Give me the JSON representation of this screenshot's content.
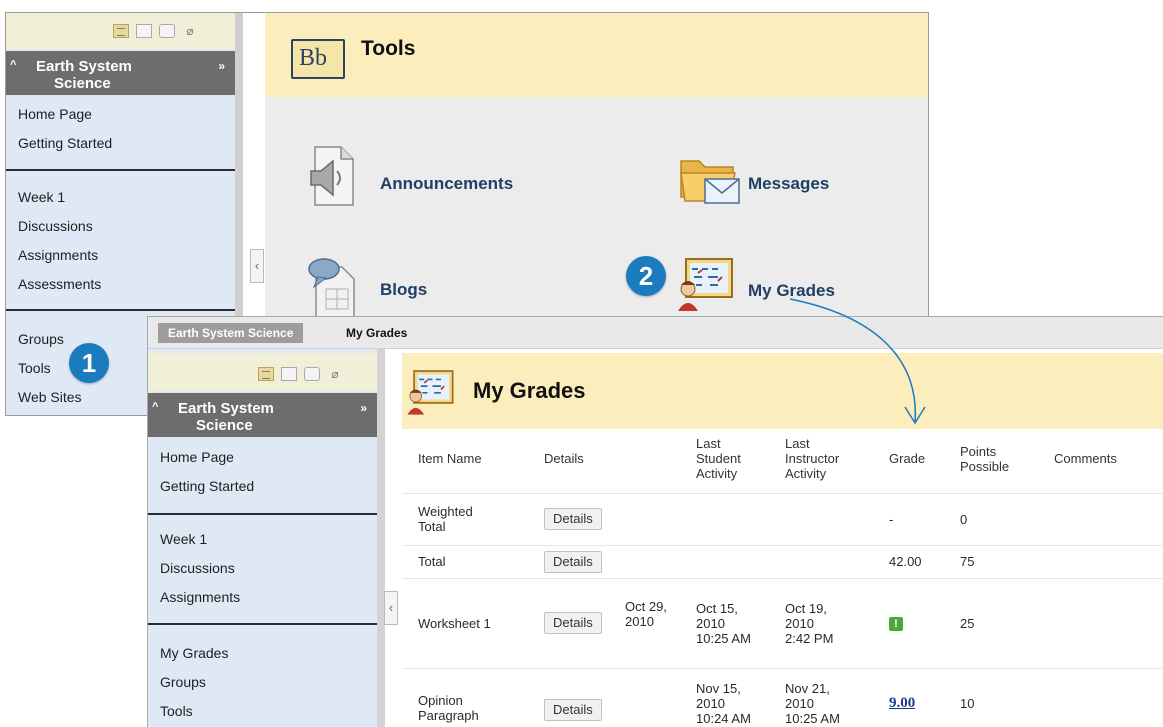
{
  "tools_window": {
    "course_title_line1": "Earth System",
    "course_title_line2": "Science",
    "page_title": "Tools",
    "logo_text": "Bb",
    "nav_group1": [
      "Home Page",
      "Getting Started"
    ],
    "nav_group2": [
      "Week 1",
      "Discussions",
      "Assignments",
      "Assessments"
    ],
    "nav_group3": [
      "Groups",
      "Tools",
      "Web Sites"
    ],
    "tools": {
      "announcements": "Announcements",
      "messages": "Messages",
      "blogs": "Blogs",
      "my_grades": "My Grades"
    },
    "callout_1": "1",
    "callout_2": "2"
  },
  "grades_window": {
    "breadcrumb_course": "Earth System Science",
    "breadcrumb_page": "My Grades",
    "course_title_line1": "Earth System",
    "course_title_line2": "Science",
    "page_title": "My Grades",
    "nav_group1": [
      "Home Page",
      "Getting Started"
    ],
    "nav_group2": [
      "Week 1",
      "Discussions",
      "Assignments"
    ],
    "nav_group3": [
      "My Grades",
      "Groups",
      "Tools"
    ],
    "columns": {
      "item_name": "Item Name",
      "details": "Details",
      "last_student_line1": "Last",
      "last_student_line2": "Student",
      "last_student_line3": "Activity",
      "last_instructor_line1": "Last",
      "last_instructor_line2": "Instructor",
      "last_instructor_line3": "Activity",
      "grade": "Grade",
      "points_line1": "Points",
      "points_line2": "Possible",
      "comments": "Comments"
    },
    "rows": [
      {
        "name_line1": "Weighted",
        "name_line2": "Total",
        "details": "Details",
        "due_line1": "",
        "due_line2": "",
        "student_line1": "",
        "student_line2": "",
        "student_line3": "",
        "instructor_line1": "",
        "instructor_line2": "",
        "instructor_line3": "",
        "grade": "-",
        "points": "0"
      },
      {
        "name_line1": "Total",
        "name_line2": "",
        "details": "Details",
        "due_line1": "",
        "due_line2": "",
        "student_line1": "",
        "student_line2": "",
        "student_line3": "",
        "instructor_line1": "",
        "instructor_line2": "",
        "instructor_line3": "",
        "grade": "42.00",
        "points": "75"
      },
      {
        "name_line1": "Worksheet 1",
        "name_line2": "",
        "details": "Details",
        "due_line1": "Oct 29,",
        "due_line2": "2010",
        "student_line1": "Oct 15,",
        "student_line2": "2010",
        "student_line3": "10:25 AM",
        "instructor_line1": "Oct 19,",
        "instructor_line2": "2010",
        "instructor_line3": "2:42 PM",
        "grade_icon": "needs-grading-icon",
        "grade_icon_text": "!",
        "points": "25"
      },
      {
        "name_line1": "Opinion",
        "name_line2": "Paragraph",
        "details": "Details",
        "due_line1": "",
        "due_line2": "",
        "student_line1": "Nov 15,",
        "student_line2": "2010",
        "student_line3": "10:24 AM",
        "instructor_line1": "Nov 21,",
        "instructor_line2": "2010",
        "instructor_line3": "10:25 AM",
        "grade": "9.00",
        "points": "10"
      }
    ]
  },
  "icons": {
    "collapse": "‹",
    "expand": "»",
    "pin": "⌀",
    "up": "^"
  },
  "colors": {
    "header_bg": "#fbeebc",
    "sidebar_bg": "#dfe9f5",
    "course_bar": "#6d6d6d",
    "callout_blue": "#1b7bbf",
    "tool_link": "#1f3f66"
  }
}
